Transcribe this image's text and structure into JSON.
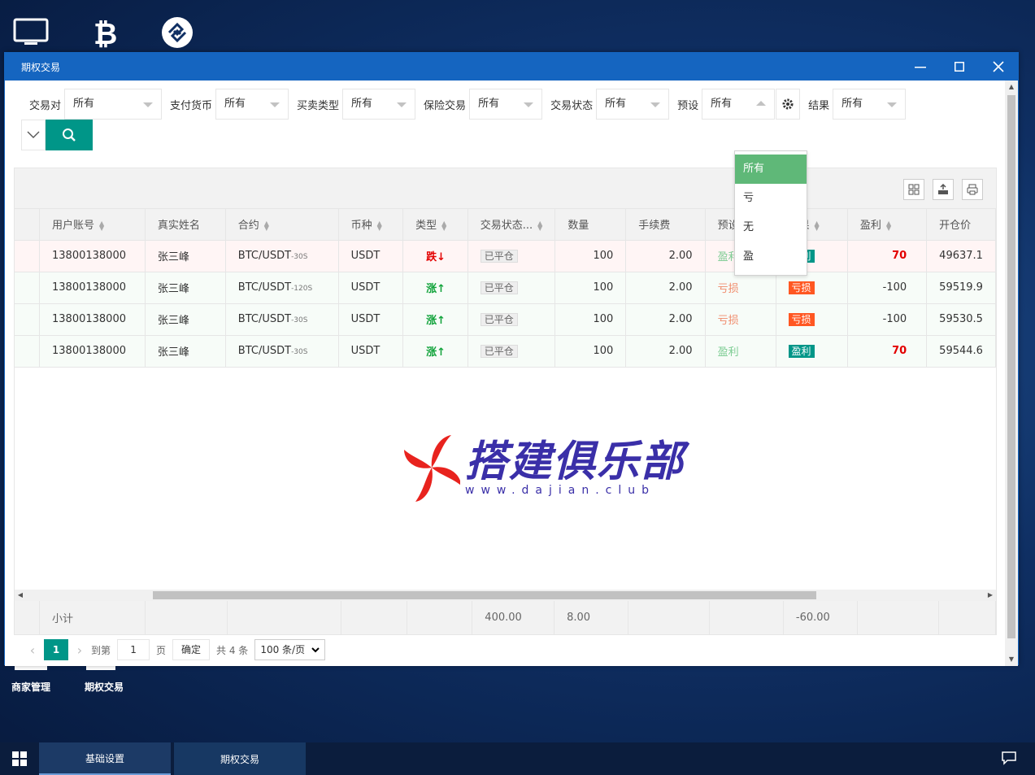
{
  "window": {
    "title": "期权交易"
  },
  "desktop": {
    "icons": [
      "monitor-icon",
      "bitcoin-icon",
      "exchange-logo-icon"
    ],
    "labels": [
      "商家管理",
      "期权交易"
    ]
  },
  "filters": [
    {
      "label": "交易对",
      "value": "所有"
    },
    {
      "label": "支付货币",
      "value": "所有"
    },
    {
      "label": "买卖类型",
      "value": "所有"
    },
    {
      "label": "保险交易",
      "value": "所有"
    },
    {
      "label": "交易状态",
      "value": "所有"
    },
    {
      "label": "预设",
      "value": "所有"
    },
    {
      "label": "结果",
      "value": "所有"
    }
  ],
  "dropdown": {
    "options": [
      "所有",
      "亏",
      "无",
      "盈"
    ],
    "selected": "所有"
  },
  "table": {
    "columns": [
      "用户账号",
      "真实姓名",
      "合约",
      "币种",
      "类型",
      "交易状态...",
      "数量",
      "手续费",
      "预设",
      "结果",
      "盈利",
      "开仓价"
    ],
    "rows": [
      {
        "account": "13800138000",
        "name": "张三峰",
        "contract": "BTC/USDT",
        "period": "-30S",
        "coin": "USDT",
        "type": "跌↓",
        "state": "已平仓",
        "qty": "100",
        "fee": "2.00",
        "preset": "盈利",
        "result": "盈利",
        "profit": "70",
        "open": "49637.1"
      },
      {
        "account": "13800138000",
        "name": "张三峰",
        "contract": "BTC/USDT",
        "period": "-120S",
        "coin": "USDT",
        "type": "涨↑",
        "state": "已平仓",
        "qty": "100",
        "fee": "2.00",
        "preset": "亏损",
        "result": "亏损",
        "profit": "-100",
        "open": "59519.9"
      },
      {
        "account": "13800138000",
        "name": "张三峰",
        "contract": "BTC/USDT",
        "period": "-30S",
        "coin": "USDT",
        "type": "涨↑",
        "state": "已平仓",
        "qty": "100",
        "fee": "2.00",
        "preset": "亏损",
        "result": "亏损",
        "profit": "-100",
        "open": "59530.5"
      },
      {
        "account": "13800138000",
        "name": "张三峰",
        "contract": "BTC/USDT",
        "period": "-30S",
        "coin": "USDT",
        "type": "涨↑",
        "state": "已平仓",
        "qty": "100",
        "fee": "2.00",
        "preset": "盈利",
        "result": "盈利",
        "profit": "70",
        "open": "59544.6"
      }
    ],
    "total": {
      "label": "小计",
      "qty": "400.00",
      "fee": "8.00",
      "profit": "-60.00"
    }
  },
  "pager": {
    "current": "1",
    "goto_label": "到第",
    "goto_value": "1",
    "page_label": "页",
    "confirm": "确定",
    "total": "共 4 条",
    "size": "100 条/页"
  },
  "watermark": {
    "text": "搭建俱乐部",
    "url": "www.dajian.club"
  },
  "taskbar": {
    "items": [
      "基础设置",
      "期权交易"
    ]
  }
}
